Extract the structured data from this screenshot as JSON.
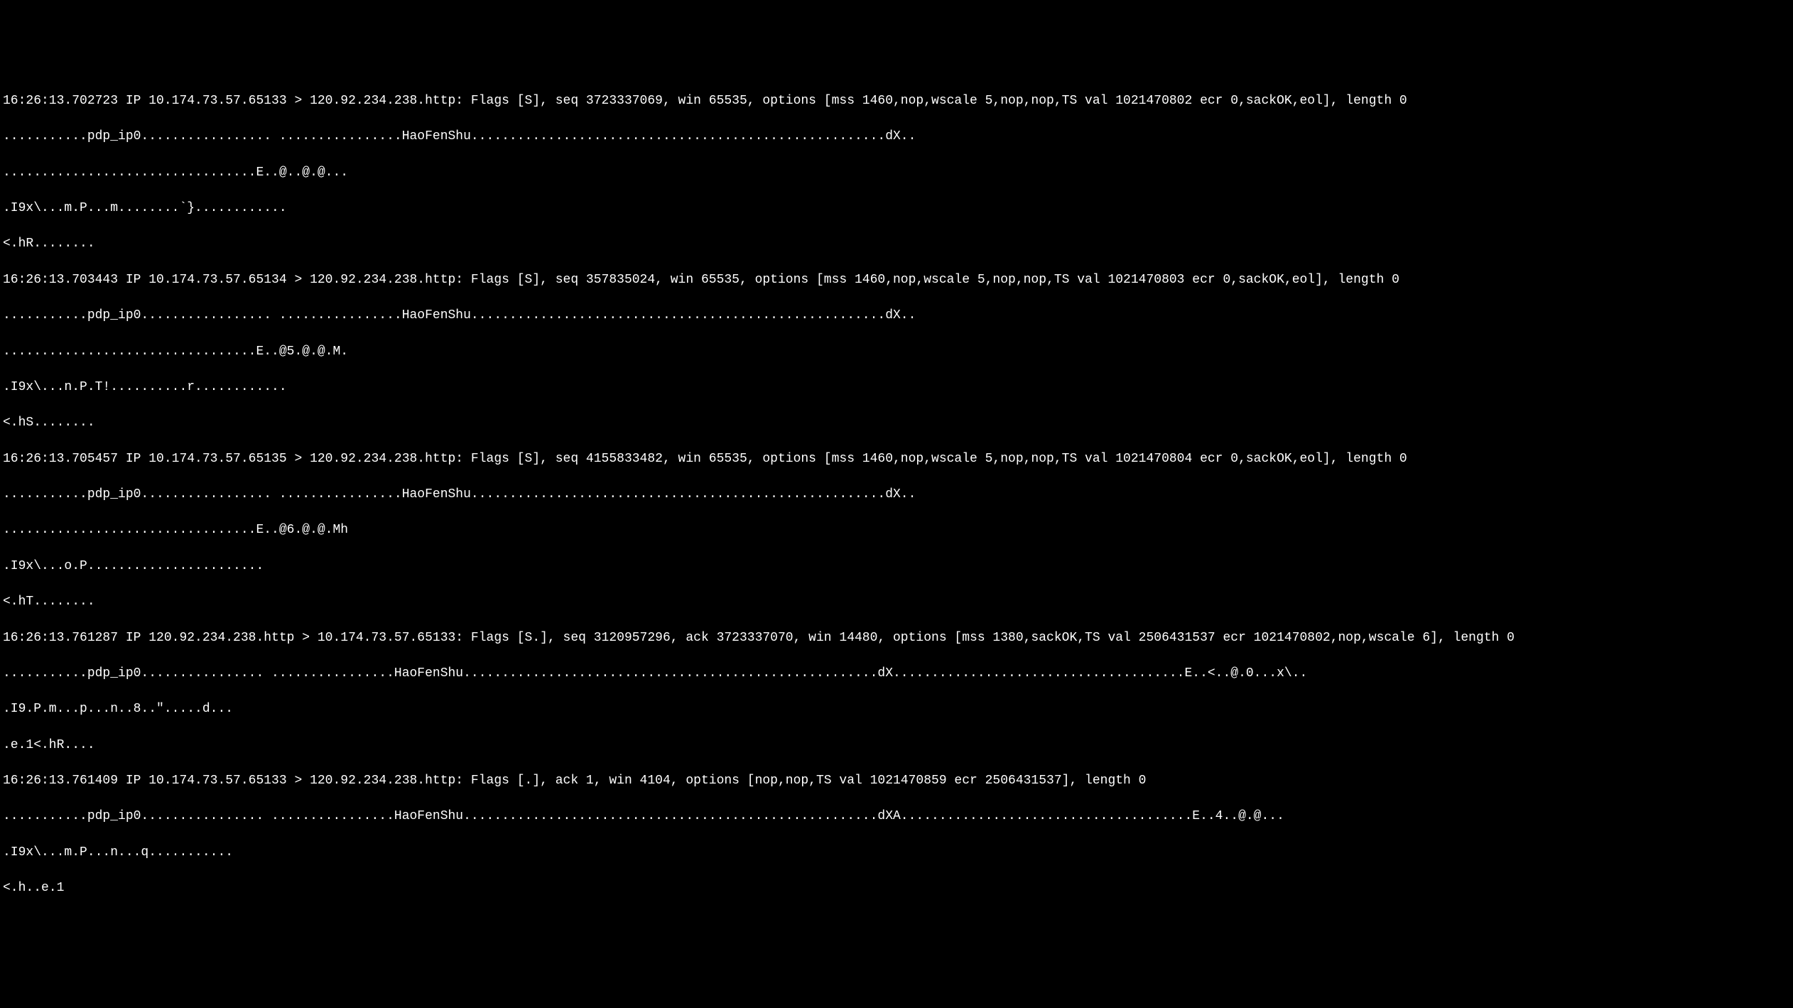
{
  "terminal": {
    "lines": [
      "16:26:13.702723 IP 10.174.73.57.65133 > 120.92.234.238.http: Flags [S], seq 3723337069, win 65535, options [mss 1460,nop,wscale 5,nop,nop,TS val 1021470802 ecr 0,sackOK,eol], length 0",
      "...........pdp_ip0................. ................HaoFenShu......................................................dX..",
      ".................................E..@..@.@...",
      ".I9x\\...m.P...m........`}............",
      "<.hR........",
      "16:26:13.703443 IP 10.174.73.57.65134 > 120.92.234.238.http: Flags [S], seq 357835024, win 65535, options [mss 1460,nop,wscale 5,nop,nop,TS val 1021470803 ecr 0,sackOK,eol], length 0",
      "...........pdp_ip0................. ................HaoFenShu......................................................dX..",
      ".................................E..@5.@.@.M.",
      ".I9x\\...n.P.T!..........r............",
      "<.hS........",
      "16:26:13.705457 IP 10.174.73.57.65135 > 120.92.234.238.http: Flags [S], seq 4155833482, win 65535, options [mss 1460,nop,wscale 5,nop,nop,TS val 1021470804 ecr 0,sackOK,eol], length 0",
      "...........pdp_ip0................. ................HaoFenShu......................................................dX..",
      ".................................E..@6.@.@.Mh",
      ".I9x\\...o.P.......................",
      "<.hT........",
      "16:26:13.761287 IP 120.92.234.238.http > 10.174.73.57.65133: Flags [S.], seq 3120957296, ack 3723337070, win 14480, options [mss 1380,sackOK,TS val 2506431537 ecr 1021470802,nop,wscale 6], length 0",
      "...........pdp_ip0................ ................HaoFenShu......................................................dX......................................E..<..@.0...x\\..",
      ".I9.P.m...p...n..8..\".....d...",
      ".e.1<.hR....",
      "16:26:13.761409 IP 10.174.73.57.65133 > 120.92.234.238.http: Flags [.], ack 1, win 4104, options [nop,nop,TS val 1021470859 ecr 2506431537], length 0",
      "...........pdp_ip0................ ................HaoFenShu......................................................dXA......................................E..4..@.@...",
      ".I9x\\...m.P...n...q...........",
      "<.h..e.1"
    ]
  }
}
